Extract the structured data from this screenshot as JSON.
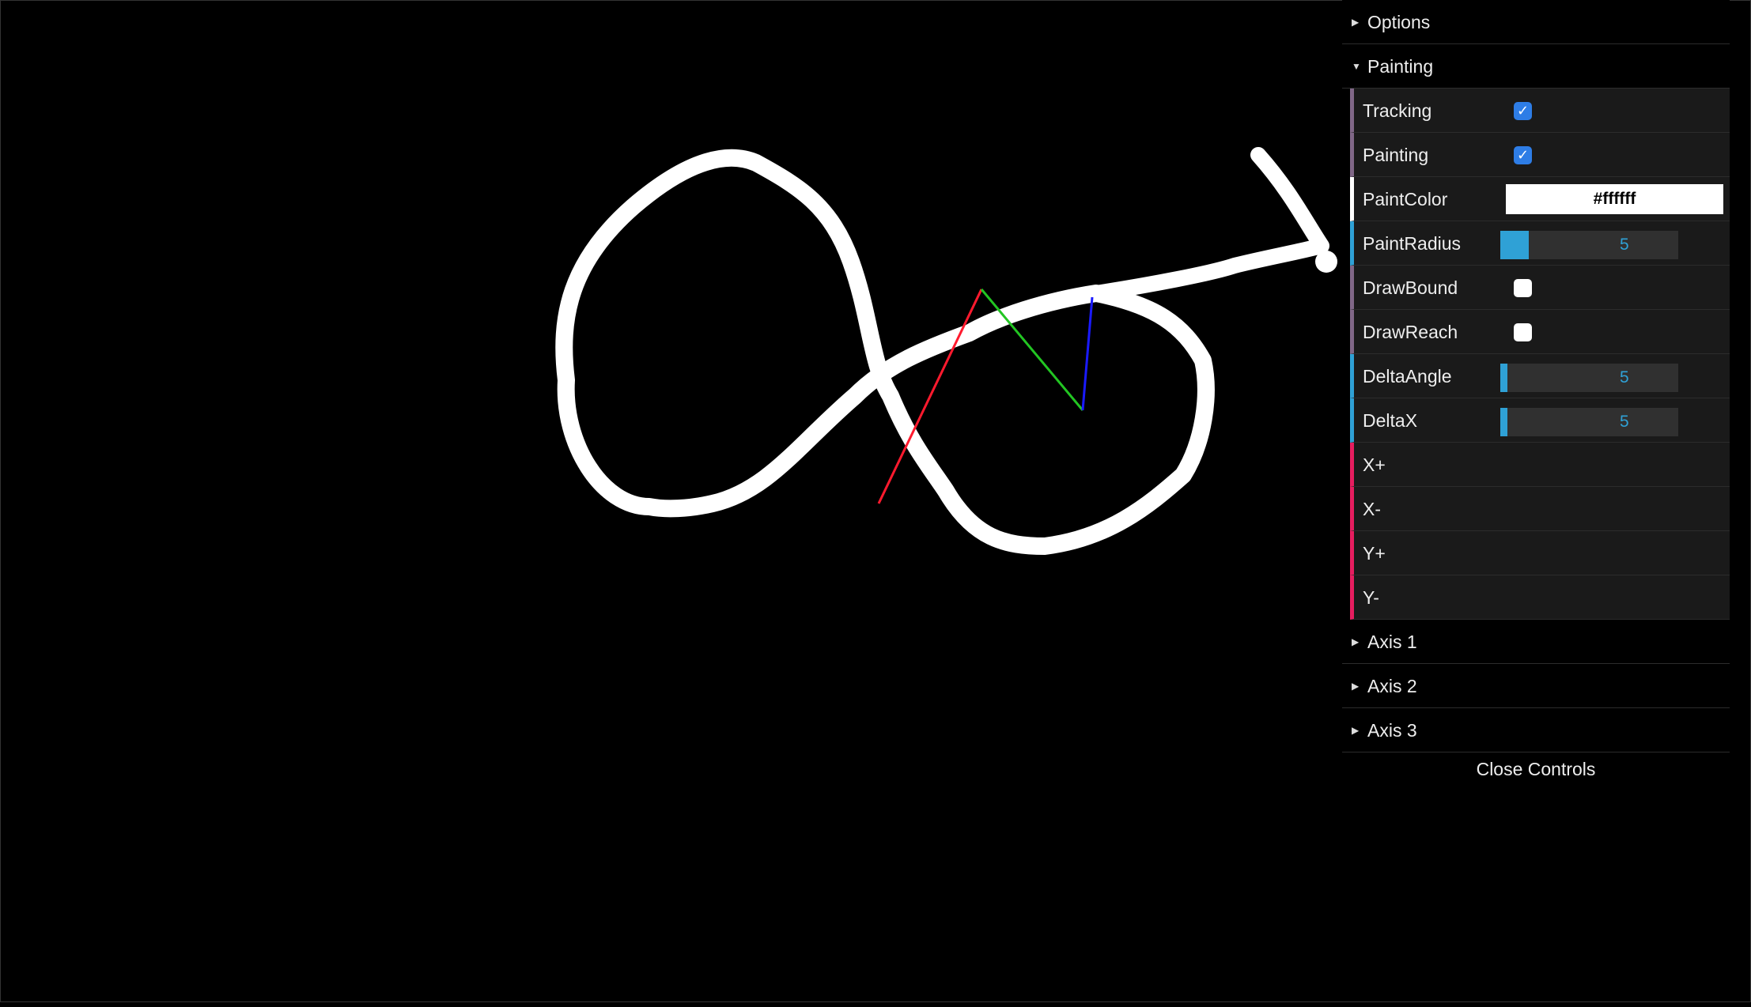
{
  "gui": {
    "folders": {
      "options": "Options",
      "painting": "Painting",
      "axis1": "Axis 1",
      "axis2": "Axis 2",
      "axis3": "Axis 3"
    },
    "painting": {
      "tracking": {
        "label": "Tracking",
        "checked": true
      },
      "painting": {
        "label": "Painting",
        "checked": true
      },
      "paint_color": {
        "label": "PaintColor",
        "value": "#ffffff"
      },
      "paint_radius": {
        "label": "PaintRadius",
        "value": "5",
        "fraction": 0.2
      },
      "draw_bound": {
        "label": "DrawBound",
        "checked": false
      },
      "draw_reach": {
        "label": "DrawReach",
        "checked": false
      },
      "delta_angle": {
        "label": "DeltaAngle",
        "value": "5",
        "fraction": 0.05
      },
      "delta_x": {
        "label": "DeltaX",
        "value": "5",
        "fraction": 0.05
      },
      "x_plus": "X+",
      "x_minus": "X-",
      "y_plus": "Y+",
      "y_minus": "Y-"
    },
    "close_label": "Close Controls",
    "check_glyph": "✓"
  },
  "colors": {
    "stroke": "#ffffff",
    "axis_x": "#ff1a2e",
    "axis_y": "#22c522",
    "axis_z": "#1a1aff",
    "accent_number": "#2fa1d6",
    "accent_function": "#e61d5f",
    "accent_boolean": "#806787",
    "checkbox_on": "#2e7de6"
  }
}
